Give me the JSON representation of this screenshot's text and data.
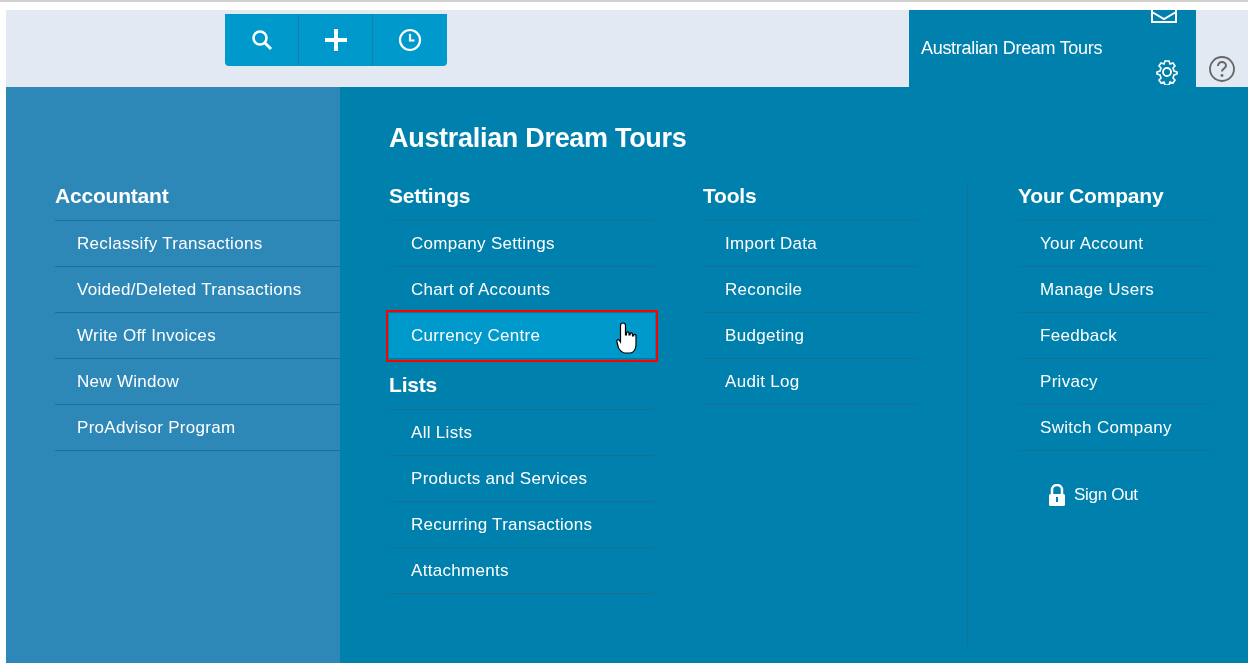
{
  "company_name": "Australian Dream Tours",
  "menu_title": "Australian Dream Tours",
  "accountant": {
    "heading": "Accountant",
    "items": [
      {
        "label": "Reclassify Transactions",
        "selected": false
      },
      {
        "label": "Voided/Deleted Transactions",
        "selected": false
      },
      {
        "label": "Write Off Invoices",
        "selected": false
      },
      {
        "label": "New Window",
        "selected": false
      },
      {
        "label": "ProAdvisor Program",
        "selected": false
      }
    ]
  },
  "sections": [
    {
      "heading": "Settings",
      "items": [
        {
          "label": "Company Settings",
          "selected": false
        },
        {
          "label": "Chart of Accounts",
          "selected": false
        },
        {
          "label": "Currency Centre",
          "selected": true
        }
      ]
    },
    {
      "heading": "Lists",
      "items": [
        {
          "label": "All Lists",
          "selected": false
        },
        {
          "label": "Products and Services",
          "selected": false
        },
        {
          "label": "Recurring Transactions",
          "selected": false
        },
        {
          "label": "Attachments",
          "selected": false
        }
      ]
    }
  ],
  "tools": {
    "heading": "Tools",
    "items": [
      {
        "label": "Import Data",
        "selected": false
      },
      {
        "label": "Reconcile",
        "selected": false
      },
      {
        "label": "Budgeting",
        "selected": false
      },
      {
        "label": "Audit Log",
        "selected": false
      }
    ]
  },
  "your_company": {
    "heading": "Your Company",
    "items": [
      {
        "label": "Your Account",
        "selected": false
      },
      {
        "label": "Manage Users",
        "selected": false
      },
      {
        "label": "Feedback",
        "selected": false
      },
      {
        "label": "Privacy",
        "selected": false
      },
      {
        "label": "Switch Company",
        "selected": false
      }
    ],
    "sign_out": "Sign Out"
  }
}
